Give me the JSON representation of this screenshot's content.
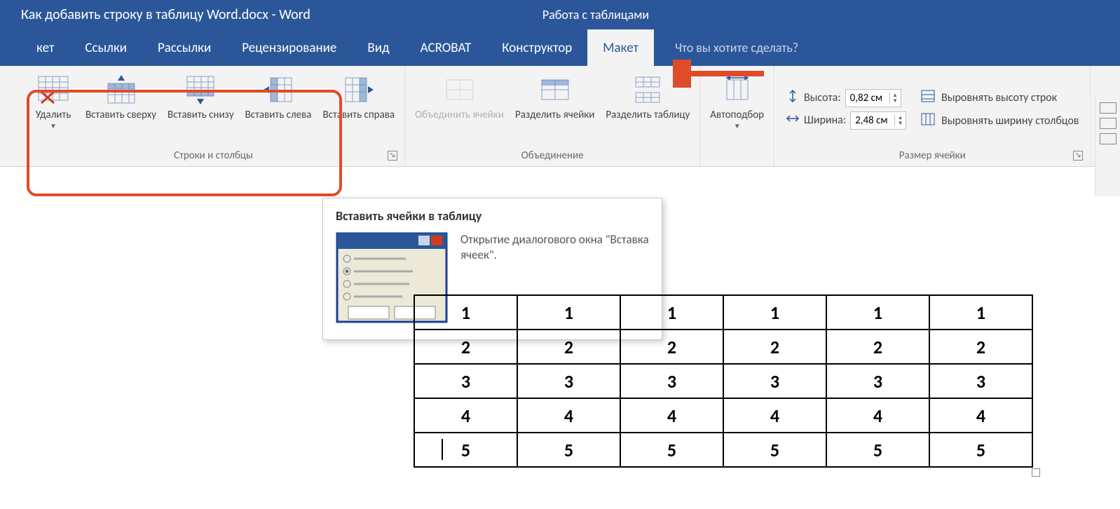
{
  "title": "Как добавить строку в таблицу Word.docx - Word",
  "context_title": "Работа с таблицами",
  "tabs": {
    "t0": "кет",
    "t1": "Ссылки",
    "t2": "Рассылки",
    "t3": "Рецензирование",
    "t4": "Вид",
    "t5": "ACROBAT",
    "t6": "Конструктор",
    "t7": "Макет"
  },
  "tell_me": "Что вы хотите сделать?",
  "groups": {
    "rows_cols": {
      "label": "Строки и столбцы",
      "delete": "Удалить",
      "insert_above": "Вставить сверху",
      "insert_below": "Вставить снизу",
      "insert_left": "Вставить слева",
      "insert_right": "Вставить справа"
    },
    "merge": {
      "label": "Объединение",
      "merge_cells": "Объединить ячейки",
      "split_cells": "Разделить ячейки",
      "split_table": "Разделить таблицу"
    },
    "autofit": "Автоподбор",
    "cell_size": {
      "label": "Размер ячейки",
      "height_label": "Высота:",
      "height_value": "0,82 см",
      "width_label": "Ширина:",
      "width_value": "2,48 см",
      "dist_rows": "Выровнять высоту строк",
      "dist_cols": "Выровнять ширину столбцов"
    }
  },
  "tooltip": {
    "title": "Вставить ячейки в таблицу",
    "desc": "Открытие диалогового окна \"Вставка ячеек\"."
  },
  "table": {
    "rows": [
      [
        "1",
        "1",
        "1",
        "1",
        "1",
        "1"
      ],
      [
        "2",
        "2",
        "2",
        "2",
        "2",
        "2"
      ],
      [
        "3",
        "3",
        "3",
        "3",
        "3",
        "3"
      ],
      [
        "4",
        "4",
        "4",
        "4",
        "4",
        "4"
      ],
      [
        "5",
        "5",
        "5",
        "5",
        "5",
        "5"
      ]
    ]
  }
}
